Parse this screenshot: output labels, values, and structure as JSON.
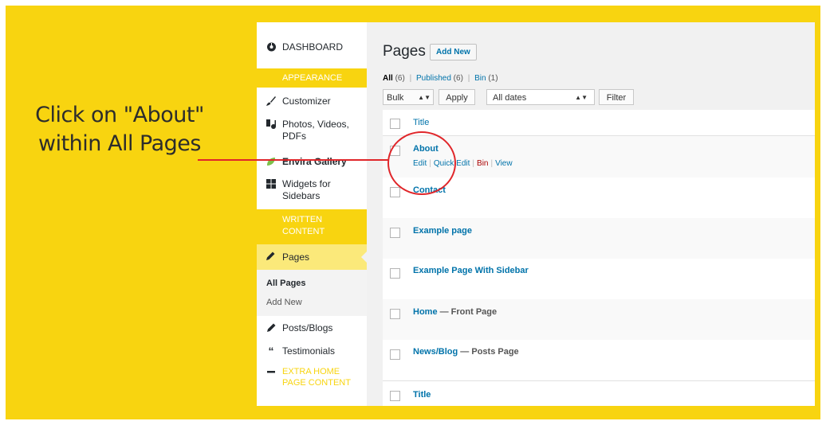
{
  "instruction": {
    "line1": "Click on \"About\"",
    "line2": "within All Pages"
  },
  "colors": {
    "background": "#f8d410",
    "highlight": "#e0262a",
    "link": "#0073aa",
    "bin": "#aa0000"
  },
  "sidebar": {
    "dashboard": {
      "icon": "dashboard-icon",
      "label": "DASHBOARD"
    },
    "section_appearance": "APPEARANCE",
    "customizer": {
      "icon": "brush-icon",
      "label": "Customizer"
    },
    "media": {
      "icon": "media-icon",
      "label": "Photos, Videos,",
      "label2": "PDFs"
    },
    "envira": {
      "icon": "leaf-icon",
      "label": "Envira Gallery"
    },
    "widgets": {
      "icon": "widgets-icon",
      "label": "Widgets for",
      "label2": "Sidebars"
    },
    "section_written": {
      "line1": "WRITTEN",
      "line2": "CONTENT"
    },
    "pages": {
      "icon": "pencil-icon",
      "label": "Pages"
    },
    "all_pages": "All Pages",
    "add_new": "Add New",
    "posts": {
      "icon": "pencil-icon",
      "label": "Posts/Blogs"
    },
    "testimonials": {
      "icon": "quote-icon",
      "label": "Testimonials"
    },
    "extra": {
      "icon": "minus-icon",
      "line1": "EXTRA HOME",
      "line2": "PAGE CONTENT"
    }
  },
  "main": {
    "title": "Pages",
    "add_new": "Add New",
    "filters": {
      "all": "All",
      "all_count": "(6)",
      "published": "Published",
      "published_count": "(6)",
      "bin": "Bin",
      "bin_count": "(1)",
      "sep": "|"
    },
    "bulk_actions": "Bulk Actions",
    "apply": "Apply",
    "all_dates": "All dates",
    "filter": "Filter",
    "column_title": "Title",
    "rows": [
      {
        "title": "About",
        "state": ""
      },
      {
        "title": "Contact",
        "state": ""
      },
      {
        "title": "Example page",
        "state": ""
      },
      {
        "title": "Example Page With Sidebar",
        "state": ""
      },
      {
        "title": "Home",
        "state": "— Front Page"
      },
      {
        "title": "News/Blog",
        "state": "— Posts Page"
      }
    ],
    "row_actions": {
      "edit": "Edit",
      "quick_edit": "Quick Edit",
      "bin": "Bin",
      "view": "View"
    },
    "footer_title": "Title"
  }
}
